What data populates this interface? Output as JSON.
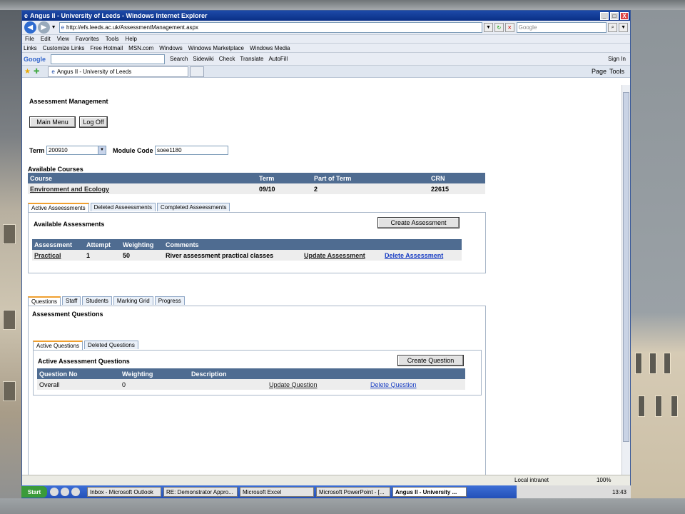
{
  "window": {
    "title": "Angus II - University of Leeds - Windows Internet Explorer",
    "minimize": "_",
    "maximize": "□",
    "close": "X"
  },
  "address": {
    "url": "http://efs.leeds.ac.uk/AssessmentManagement.aspx",
    "search_placeholder": "Google"
  },
  "menu": [
    "File",
    "Edit",
    "View",
    "Favorites",
    "Tools",
    "Help"
  ],
  "links": [
    "Links",
    "Customize Links",
    "Free Hotmail",
    "MSN.com",
    "Windows",
    "Windows Marketplace",
    "Windows Media"
  ],
  "google_toolbar": {
    "logo": "Google",
    "items": [
      "Search",
      "Sidewiki",
      "Check",
      "Translate",
      "AutoFill"
    ],
    "sign_in": "Sign In"
  },
  "browser_tab": {
    "label": "Angus II - University of Leeds"
  },
  "command_bar": [
    "Page",
    "Tools"
  ],
  "page": {
    "title": "Assessment Management",
    "main_menu": "Main Menu",
    "log_off": "Log Off",
    "term_label": "Term",
    "term_value": "200910",
    "module_label": "Module Code",
    "module_value": "soee1180",
    "available_courses": "Available Courses",
    "courses": {
      "headers": [
        "Course",
        "Term",
        "Part of Term",
        "CRN"
      ],
      "rows": [
        [
          "Environment and Ecology",
          "09/10",
          "2",
          "22615"
        ]
      ]
    },
    "assessment_tabs": [
      "Active Asseessments",
      "Deleted Asseessments",
      "Completed Asseessments"
    ],
    "available_assessments": "Available Assessments",
    "create_assessment": "Create Assessment",
    "assessments": {
      "headers": [
        "Assessment",
        "Attempt",
        "Weighting",
        "Comments",
        "",
        ""
      ],
      "rows": [
        [
          "Practical",
          "1",
          "50",
          "River assessment practical classes",
          "Update Assessment",
          "Delete Assessment"
        ]
      ]
    },
    "question_tabs": [
      "Questions",
      "Staff",
      "Students",
      "Marking Grid",
      "Progress"
    ],
    "assessment_questions": "Assessment Questions",
    "sub_tabs": [
      "Active Questions",
      "Deleted Questions"
    ],
    "active_questions": "Active Assessment Questions",
    "create_question": "Create Question",
    "questions": {
      "headers": [
        "Question No",
        "Weighting",
        "Description",
        "",
        ""
      ],
      "rows": [
        [
          "Overall",
          "0",
          "",
          "Update Question",
          "Delete Question"
        ]
      ]
    }
  },
  "status": {
    "zone": "Local intranet",
    "zoom": "100%"
  },
  "taskbar": {
    "start": "Start",
    "tasks": [
      "Inbox - Microsoft Outlook",
      "RE: Demonstrator Appro...",
      "Microsoft Excel",
      "Microsoft PowerPoint - [...",
      "Angus II - University ..."
    ],
    "clock": "13:43"
  }
}
